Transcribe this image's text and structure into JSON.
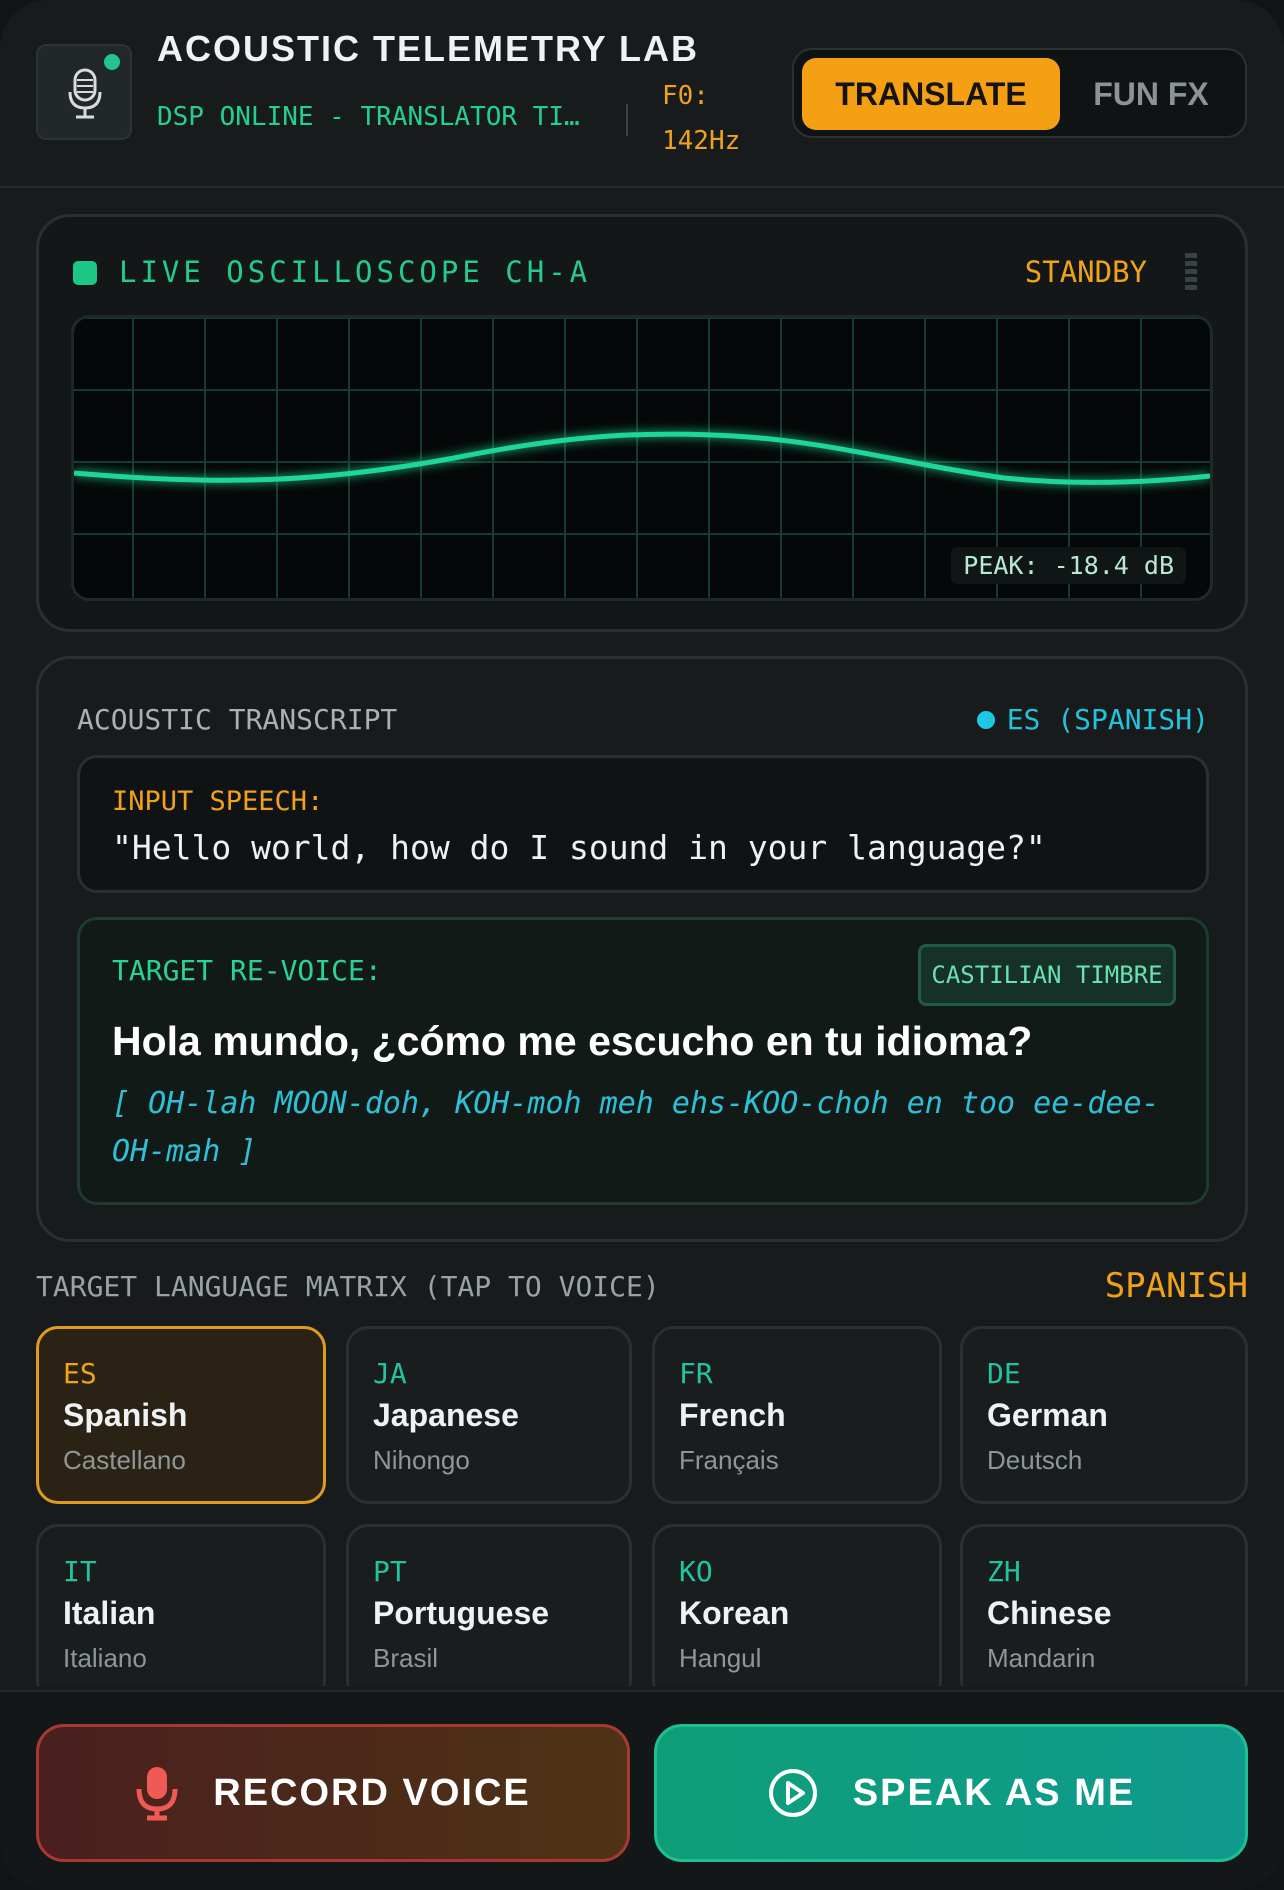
{
  "header": {
    "title": "ACOUSTIC TELEMETRY LAB",
    "status": "DSP ONLINE - TRANSLATOR TIMBRE",
    "f0_label": "F0:",
    "f0_value": "142Hz",
    "modes": [
      "TRANSLATE",
      "FUN FX"
    ],
    "active_mode": "TRANSLATE",
    "icons": {
      "badge": "microphone-icon",
      "status": "online-dot"
    }
  },
  "oscilloscope": {
    "label": "LIVE OSCILLOSCOPE CH-A",
    "state": "STANDBY",
    "peak": "PEAK: -18.4 dB",
    "trace_color": "#1fd69a",
    "grid_color": "#16342c"
  },
  "transcript": {
    "title": "ACOUSTIC TRANSCRIPT",
    "language_tag": "ES (SPANISH)",
    "input_label": "INPUT SPEECH:",
    "input_text": "\"Hello world, how do I sound in your language?\"",
    "target_label": "TARGET RE-VOICE:",
    "timbre_badge": "CASTILIAN TIMBRE",
    "target_text": "Hola mundo, ¿cómo me escucho en tu idioma?",
    "phonetic": "[ OH-lah MOON-doh, KOH-moh meh ehs-KOO-choh en too ee-dee-OH-mah ]"
  },
  "matrix": {
    "label": "TARGET LANGUAGE MATRIX (TAP TO VOICE)",
    "selected_name": "SPANISH",
    "languages": [
      {
        "code": "ES",
        "name": "Spanish",
        "native": "Castellano",
        "selected": true
      },
      {
        "code": "JA",
        "name": "Japanese",
        "native": "Nihongo",
        "selected": false
      },
      {
        "code": "FR",
        "name": "French",
        "native": "Français",
        "selected": false
      },
      {
        "code": "DE",
        "name": "German",
        "native": "Deutsch",
        "selected": false
      },
      {
        "code": "IT",
        "name": "Italian",
        "native": "Italiano",
        "selected": false
      },
      {
        "code": "PT",
        "name": "Portuguese",
        "native": "Brasil",
        "selected": false
      },
      {
        "code": "KO",
        "name": "Korean",
        "native": "Hangul",
        "selected": false
      },
      {
        "code": "ZH",
        "name": "Chinese",
        "native": "Mandarin",
        "selected": false
      }
    ]
  },
  "actions": {
    "record_label": "RECORD VOICE",
    "speak_label": "SPEAK AS ME",
    "record_icon": "microphone-icon",
    "speak_icon": "play-circle-icon",
    "colors": {
      "accent": "#f59f12",
      "record": "#e84a4a",
      "speak": "#0d9e78"
    }
  }
}
